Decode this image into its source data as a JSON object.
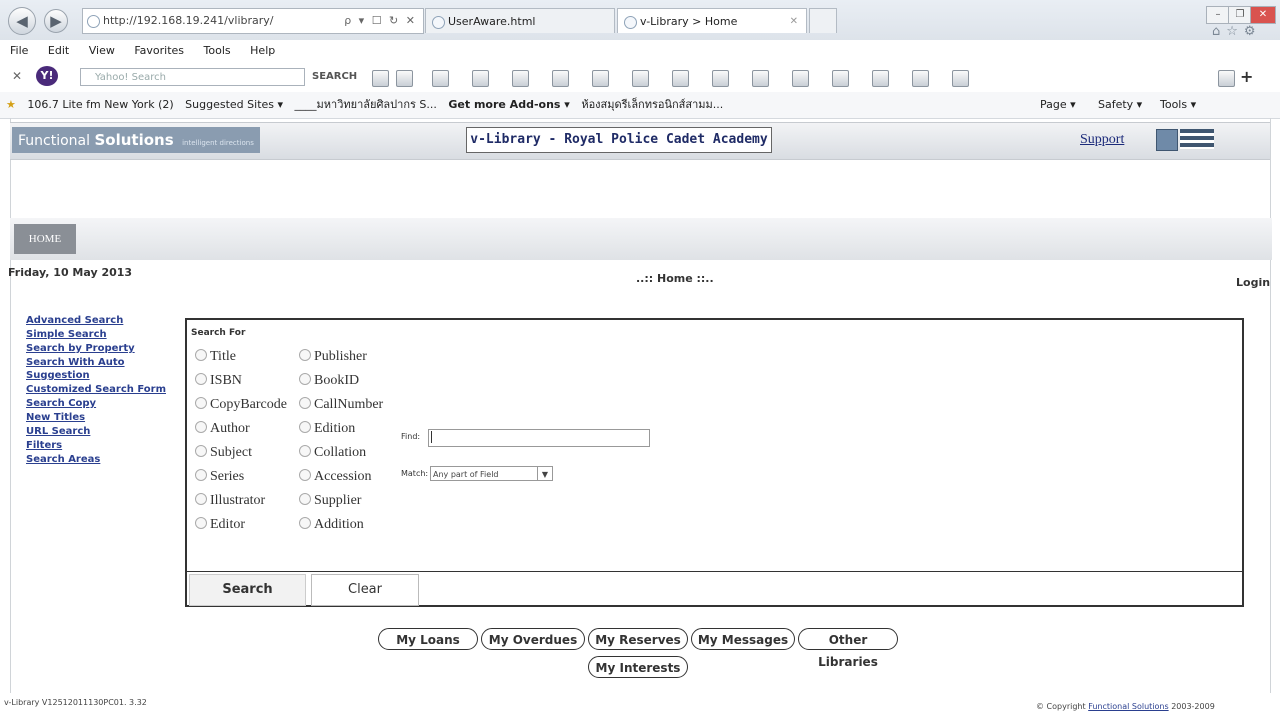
{
  "browser": {
    "address_url": "http://192.168.19.241/vlibrary/",
    "address_controls": "ρ ▾ ☐ ↻ ✕",
    "tabs": [
      {
        "label": "UserAware.html"
      },
      {
        "label": "v-Library > Home"
      }
    ],
    "tab_close": "✕",
    "menu": [
      "File",
      "Edit",
      "View",
      "Favorites",
      "Tools",
      "Help"
    ],
    "yahoo_search_placeholder": "Yahoo! Search",
    "search_button": "SEARCH",
    "favorites": [
      "106.7 Lite fm New York (2)",
      "Suggested Sites ▾",
      "____มหาวิทยาลัยศิลปากร S...",
      "Get more Add-ons ▾",
      "ห้องสมุดรีเล็กทรอนิกส์สามม..."
    ],
    "command_bar": [
      "Page ▾",
      "Safety ▾",
      "Tools ▾"
    ]
  },
  "page": {
    "logo": {
      "brand_regular": "Functional",
      "brand_bold": "Solutions",
      "tagline": "intelligent directions"
    },
    "site_title": "v-Library - Royal Police Cadet Academy",
    "support_link": "Support",
    "home_button": "HOME",
    "date": "Friday, 10 May 2013",
    "breadcrumb": "..:: Home ::..",
    "login": "Login",
    "sidebar": [
      "Advanced Search",
      "Simple Search",
      "Search by Property",
      "Search With Auto Suggestion",
      "Customized Search Form",
      "Search Copy",
      "New Titles",
      "URL Search",
      "Filters",
      "Search Areas"
    ],
    "search": {
      "heading": "Search For",
      "options_col1": [
        "Title",
        "ISBN",
        "CopyBarcode",
        "Author",
        "Subject",
        "Series",
        "Illustrator",
        "Editor"
      ],
      "options_col2": [
        "Publisher",
        "BookID",
        "CallNumber",
        "Edition",
        "Collation",
        "Accession",
        "Supplier",
        "Addition"
      ],
      "find_label": "Find:",
      "find_value": "",
      "match_label": "Match:",
      "match_value": "Any part of Field",
      "search_button": "Search",
      "clear_button": "Clear"
    },
    "account_buttons": [
      "My Loans",
      "My Overdues",
      "My Reserves",
      "My Messages",
      "Other Libraries",
      "My Interests"
    ],
    "footer_version": "v-Library V12512011130PC01. 3.32",
    "footer_copyright_prefix": "© Copyright",
    "footer_copyright_link": "Functional Solutions",
    "footer_copyright_years": "2003-2009"
  }
}
